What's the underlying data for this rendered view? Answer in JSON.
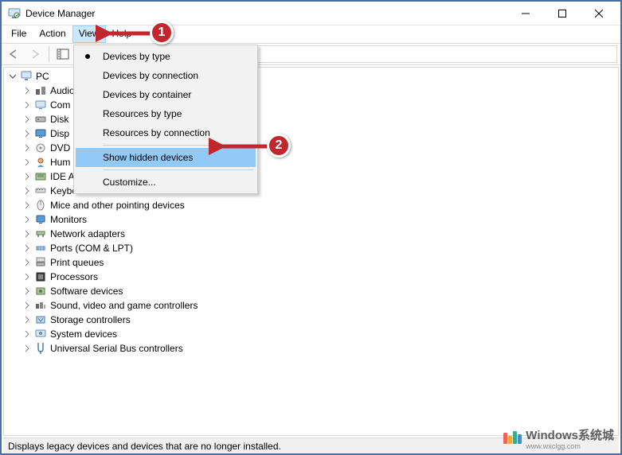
{
  "window": {
    "title": "Device Manager"
  },
  "menubar": {
    "file": "File",
    "action": "Action",
    "view": "View",
    "help": "Help"
  },
  "dropdown": {
    "devices_by_type": "Devices by type",
    "devices_by_connection": "Devices by connection",
    "devices_by_container": "Devices by container",
    "resources_by_type": "Resources by type",
    "resources_by_connection": "Resources by connection",
    "show_hidden": "Show hidden devices",
    "customize": "Customize..."
  },
  "tree": {
    "root": "PC",
    "items": [
      "Audio",
      "Com",
      "Disk",
      "Disp",
      "DVD",
      "Hum",
      "IDE A",
      "Keyboards",
      "Mice and other pointing devices",
      "Monitors",
      "Network adapters",
      "Ports (COM & LPT)",
      "Print queues",
      "Processors",
      "Software devices",
      "Sound, video and game controllers",
      "Storage controllers",
      "System devices",
      "Universal Serial Bus controllers"
    ]
  },
  "statusbar": {
    "text": "Displays legacy devices and devices that are no longer installed."
  },
  "annotations": {
    "step1": "1",
    "step2": "2"
  },
  "watermark": {
    "brand": "Windows系统城",
    "url": "www.wxclgg.com"
  }
}
